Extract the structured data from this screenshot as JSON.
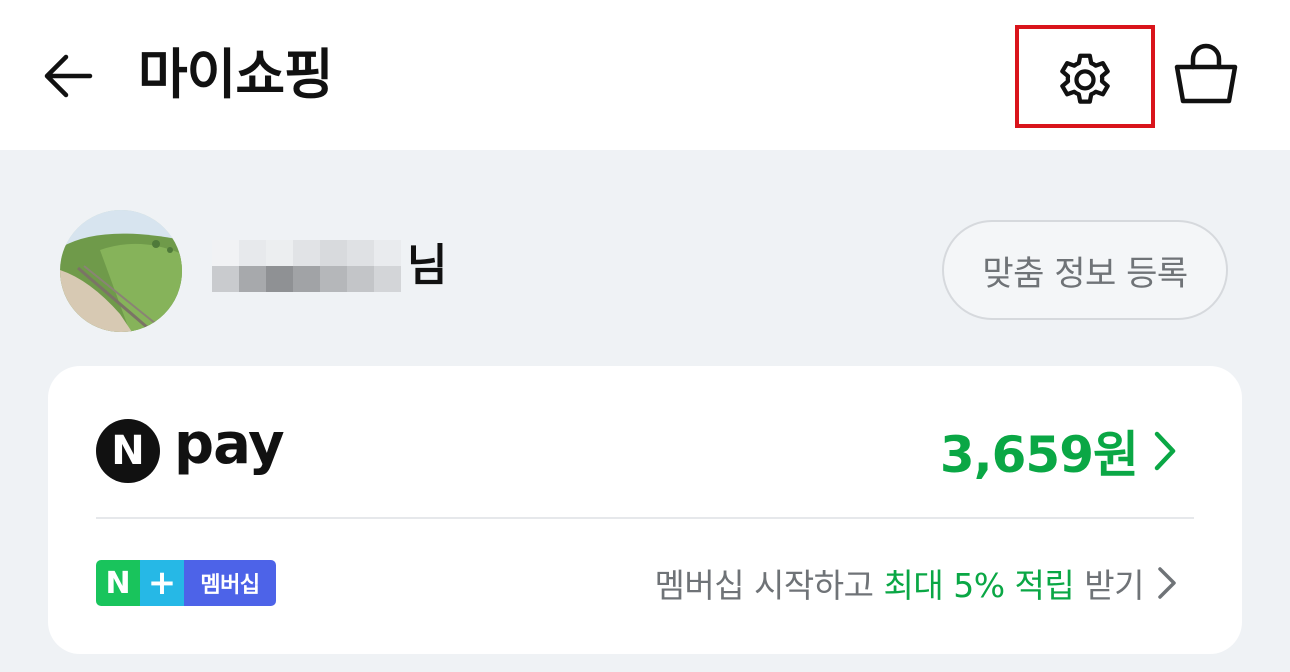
{
  "header": {
    "title": "마이쇼핑",
    "back_icon": "arrow-left-icon",
    "settings_icon": "gear-icon",
    "cart_icon": "shopping-bag-icon",
    "highlight_color": "#d9141b"
  },
  "profile": {
    "name_suffix": "님",
    "custom_info_button": "맞춤 정보 등록"
  },
  "npay": {
    "logo_letter": "N",
    "logo_text": "pay",
    "balance": "3,659원",
    "balance_color": "#0aa745"
  },
  "membership": {
    "badge_n": "N",
    "badge_plus": "+",
    "badge_label": "멤버십",
    "promo_prefix": "멤버십 시작하고",
    "promo_highlight": "최대 5% 적립",
    "promo_suffix": "받기"
  }
}
